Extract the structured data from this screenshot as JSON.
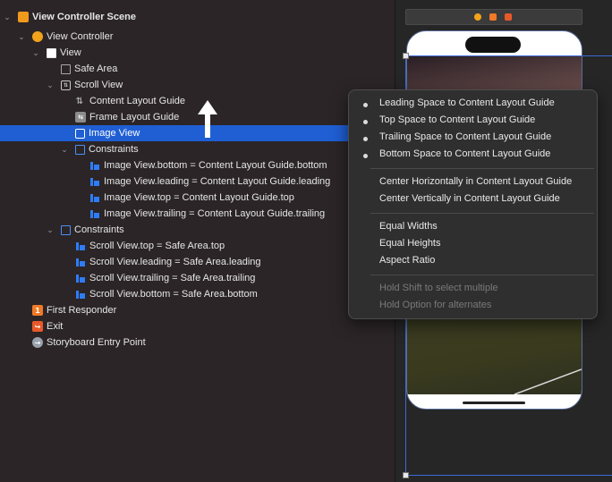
{
  "outline": {
    "items": [
      {
        "label": "View Controller Scene",
        "icon": "scene-icon",
        "disclosure": "expanded",
        "bold": true
      },
      {
        "label": "View Controller",
        "icon": "view-controller-icon",
        "disclosure": "expanded"
      },
      {
        "label": "View",
        "icon": "view-icon",
        "disclosure": "expanded"
      },
      {
        "label": "Safe Area",
        "icon": "safe-area-icon",
        "disclosure": ""
      },
      {
        "label": "Scroll View",
        "icon": "scroll-view-icon",
        "disclosure": "expanded"
      },
      {
        "label": "Content Layout Guide",
        "icon": "layout-guide-icon",
        "disclosure": ""
      },
      {
        "label": "Frame Layout Guide",
        "icon": "frame-guide-icon",
        "disclosure": ""
      },
      {
        "label": "Image View",
        "icon": "image-view-icon",
        "disclosure": "",
        "selected": true
      },
      {
        "label": "Constraints",
        "icon": "constraints-icon",
        "disclosure": "expanded"
      },
      {
        "label": "Image View.bottom = Content Layout Guide.bottom",
        "icon": "constraint-icon",
        "disclosure": ""
      },
      {
        "label": "Image View.leading = Content Layout Guide.leading",
        "icon": "constraint-icon",
        "disclosure": ""
      },
      {
        "label": "Image View.top = Content Layout Guide.top",
        "icon": "constraint-icon",
        "disclosure": ""
      },
      {
        "label": "Image View.trailing = Content Layout Guide.trailing",
        "icon": "constraint-icon",
        "disclosure": ""
      },
      {
        "label": "Constraints",
        "icon": "constraints-icon",
        "disclosure": "expanded"
      },
      {
        "label": "Scroll View.top = Safe Area.top",
        "icon": "constraint-icon",
        "disclosure": ""
      },
      {
        "label": "Scroll View.leading = Safe Area.leading",
        "icon": "constraint-icon",
        "disclosure": ""
      },
      {
        "label": "Scroll View.trailing = Safe Area.trailing",
        "icon": "constraint-icon",
        "disclosure": ""
      },
      {
        "label": "Scroll View.bottom = Safe Area.bottom",
        "icon": "constraint-icon",
        "disclosure": ""
      },
      {
        "label": "First Responder",
        "icon": "first-responder-icon",
        "disclosure": ""
      },
      {
        "label": "Exit",
        "icon": "exit-icon",
        "disclosure": ""
      },
      {
        "label": "Storyboard Entry Point",
        "icon": "entry-point-icon",
        "disclosure": ""
      }
    ]
  },
  "menu": {
    "group1": [
      {
        "label": "Leading Space to Content Layout Guide",
        "checked": true
      },
      {
        "label": "Top Space to Content Layout Guide",
        "checked": true
      },
      {
        "label": "Trailing Space to Content Layout Guide",
        "checked": true
      },
      {
        "label": "Bottom Space to Content Layout Guide",
        "checked": true
      }
    ],
    "group2": [
      {
        "label": "Center Horizontally in Content Layout Guide"
      },
      {
        "label": "Center Vertically in Content Layout Guide"
      }
    ],
    "group3": [
      {
        "label": "Equal Widths"
      },
      {
        "label": "Equal Heights"
      },
      {
        "label": "Aspect Ratio"
      }
    ],
    "hints": [
      {
        "label": "Hold Shift to select multiple"
      },
      {
        "label": "Hold Option for alternates"
      }
    ]
  },
  "colors": {
    "selection": "#1f5fd3",
    "constraint": "#2f7cf6",
    "accent": "#f09a1c"
  }
}
